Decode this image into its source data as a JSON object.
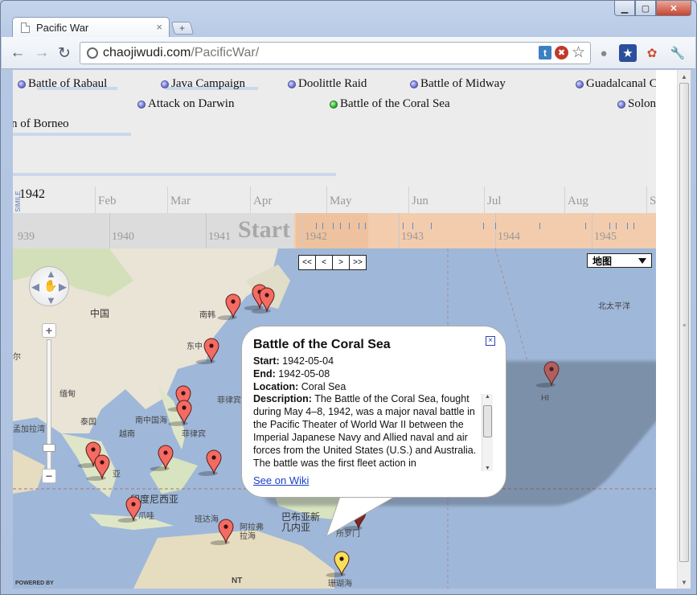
{
  "browser": {
    "tab_title": "Pacific War",
    "tab_close": "×",
    "new_tab": "+",
    "url_host": "chaojiwudi.com",
    "url_path": "/PacificWar/",
    "window_controls": {
      "minimize": "▁",
      "maximize": "▢",
      "close": "✕"
    }
  },
  "timeline": {
    "events": [
      {
        "label": "Battle of Rabaul",
        "dot": "blue"
      },
      {
        "label": "Java Campaign",
        "dot": "blue"
      },
      {
        "label": "Doolittle Raid",
        "dot": "blue"
      },
      {
        "label": "Battle of Midway",
        "dot": "blue"
      },
      {
        "label": "Guadalcanal C",
        "dot": "blue"
      },
      {
        "label": "Attack on Darwin",
        "dot": "blue"
      },
      {
        "label": "Battle of the Coral Sea",
        "dot": "green"
      },
      {
        "label": "Solon",
        "dot": "blue"
      },
      {
        "label": "n of Borneo",
        "dot": "none"
      }
    ],
    "year_label": "1942",
    "months": [
      "Feb",
      "Mar",
      "Apr",
      "May",
      "Jun",
      "Jul",
      "Aug",
      "S"
    ],
    "credit": "Timeline © SIMILE"
  },
  "overview": {
    "years": [
      "939",
      "1940",
      "1941",
      "1942",
      "1943",
      "1944",
      "1945"
    ],
    "start_label": "Start"
  },
  "map": {
    "nav_buttons": [
      "<<",
      "<",
      ">",
      ">>"
    ],
    "map_type": "地图",
    "labels": {
      "china": "中国",
      "korea": "南韩",
      "east_china_sea": "东中",
      "burma": "缅甸",
      "thailand": "泰国",
      "vietnam": "越南",
      "south_china_sea": "南中国海",
      "philippines": "菲律宾",
      "philippine_sea": "菲律宾",
      "bangladesh": "孟加拉湾",
      "malaysia": "亚",
      "indonesia": "印度尼西亚",
      "java_sea": "爪哇",
      "banda_sea": "班达海",
      "arafura": "阿拉弗拉海",
      "png": "巴布亚新几内亚",
      "solomon": "所罗门",
      "coral_sea": "珊瑚海",
      "north_pacific": "北太平洋",
      "hawaii": "HI",
      "nt": "NT",
      "india_frag": "尔"
    },
    "powered_by": "POWERED BY"
  },
  "popup": {
    "title": "Battle of the Coral Sea",
    "start_label": "Start:",
    "start_value": "1942-05-04",
    "end_label": "End:",
    "end_value": "1942-05-08",
    "location_label": "Location:",
    "location_value": "Coral Sea",
    "description_label": "Description:",
    "description_value": "The Battle of the Coral Sea, fought during May 4–8, 1942, was a major naval battle in the Pacific Theater of World War II between the Imperial Japanese Navy and Allied naval and air forces from the United States (U.S.) and Australia. The battle was the first fleet action in",
    "link": "See on Wiki",
    "close": "×"
  },
  "colors": {
    "pin_red": "#f46b63",
    "pin_selected": "#f6e05a",
    "pin_dark": "#7a2a22"
  }
}
